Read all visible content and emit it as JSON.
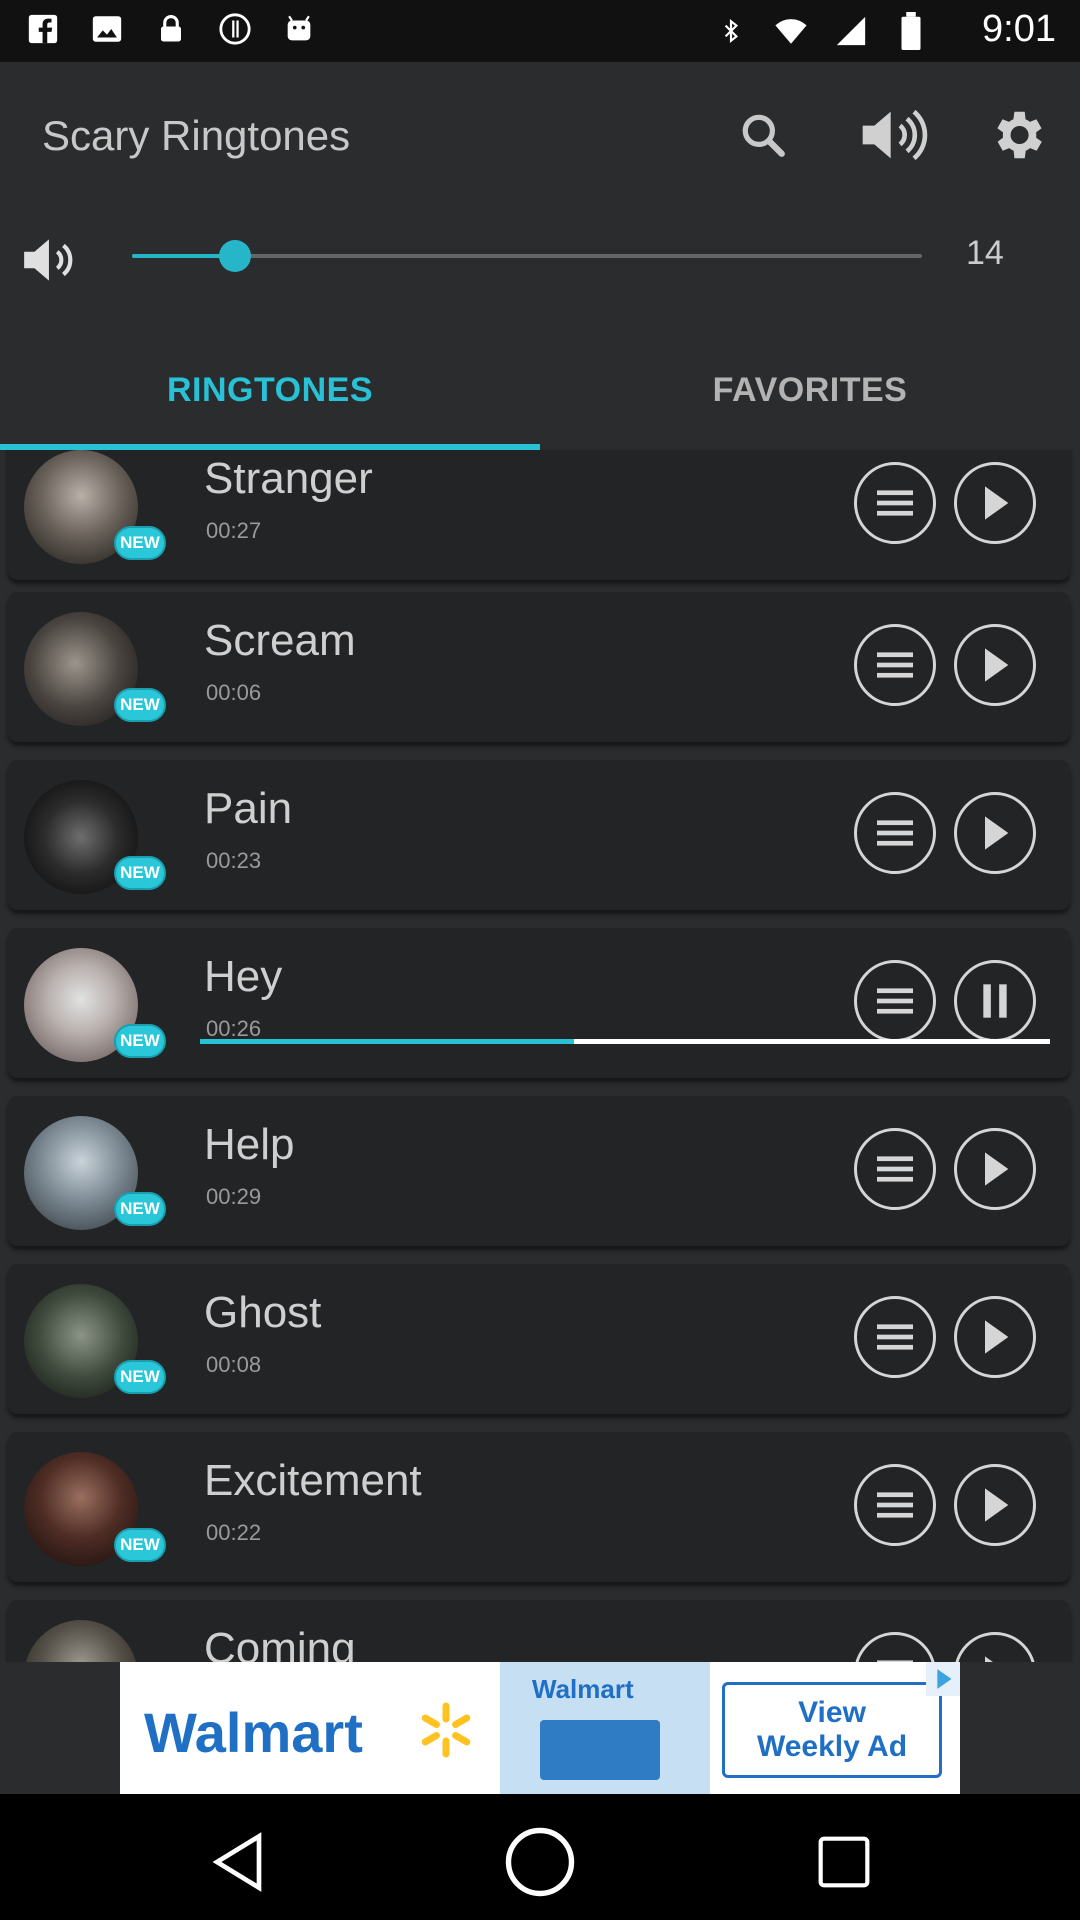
{
  "status_bar": {
    "time": "9:01",
    "left_icons": [
      "facebook-icon",
      "image-icon",
      "lock-icon",
      "info-icon",
      "android-icon"
    ],
    "right_icons": [
      "bluetooth-icon",
      "wifi-icon",
      "signal-icon",
      "battery-icon"
    ]
  },
  "app_bar": {
    "title": "Scary Ringtones",
    "actions": [
      "search-icon",
      "volume-icon",
      "settings-icon"
    ]
  },
  "volume": {
    "value_label": "14",
    "level_fraction": 0.13,
    "accent_color": "#29c1d6"
  },
  "tabs": [
    {
      "label": "RINGTONES",
      "selected": true
    },
    {
      "label": "FAVORITES",
      "selected": false
    }
  ],
  "ringtones": [
    {
      "title": "Stranger",
      "duration": "00:27",
      "badge": "NEW",
      "state": "play"
    },
    {
      "title": "Scream",
      "duration": "00:06",
      "badge": "NEW",
      "state": "play"
    },
    {
      "title": "Pain",
      "duration": "00:23",
      "badge": "NEW",
      "state": "play"
    },
    {
      "title": "Hey",
      "duration": "00:26",
      "badge": "NEW",
      "state": "pause",
      "progress_fraction": 0.44
    },
    {
      "title": "Help",
      "duration": "00:29",
      "badge": "NEW",
      "state": "play"
    },
    {
      "title": "Ghost",
      "duration": "00:08",
      "badge": "NEW",
      "state": "play"
    },
    {
      "title": "Excitement",
      "duration": "00:22",
      "badge": "NEW",
      "state": "play"
    },
    {
      "title": "Coming",
      "duration": "",
      "badge": "",
      "state": "play"
    }
  ],
  "ad": {
    "brand": "Walmart",
    "mid_brand": "Walmart",
    "cta_line1": "View",
    "cta_line2": "Weekly Ad"
  },
  "nav_bar": {
    "buttons": [
      "back-icon",
      "home-icon",
      "recents-icon"
    ]
  }
}
